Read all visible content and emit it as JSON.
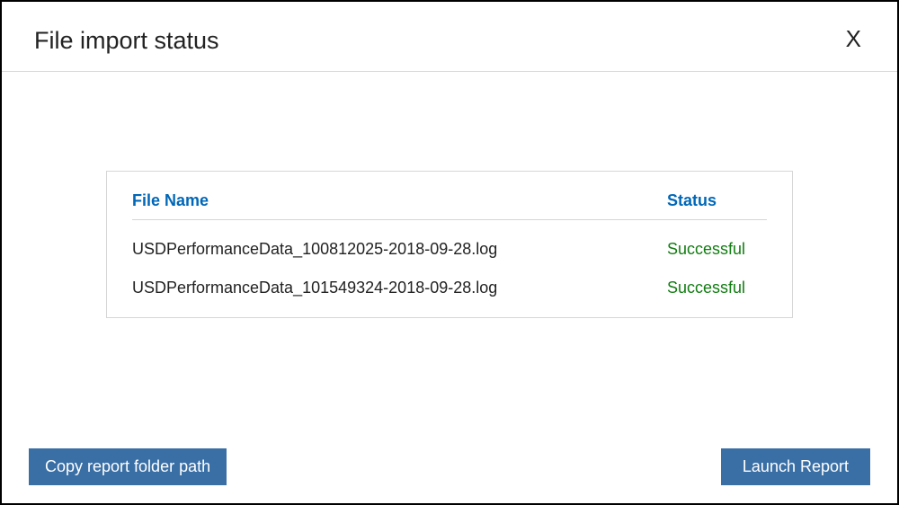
{
  "dialog": {
    "title": "File import status",
    "close_label": "X"
  },
  "table": {
    "headers": {
      "filename": "File Name",
      "status": "Status"
    },
    "rows": [
      {
        "filename": "USDPerformanceData_100812025-2018-09-28.log",
        "status": "Successful"
      },
      {
        "filename": "USDPerformanceData_101549324-2018-09-28.log",
        "status": "Successful"
      }
    ]
  },
  "footer": {
    "copy_path_label": "Copy report folder path",
    "launch_report_label": "Launch Report"
  }
}
